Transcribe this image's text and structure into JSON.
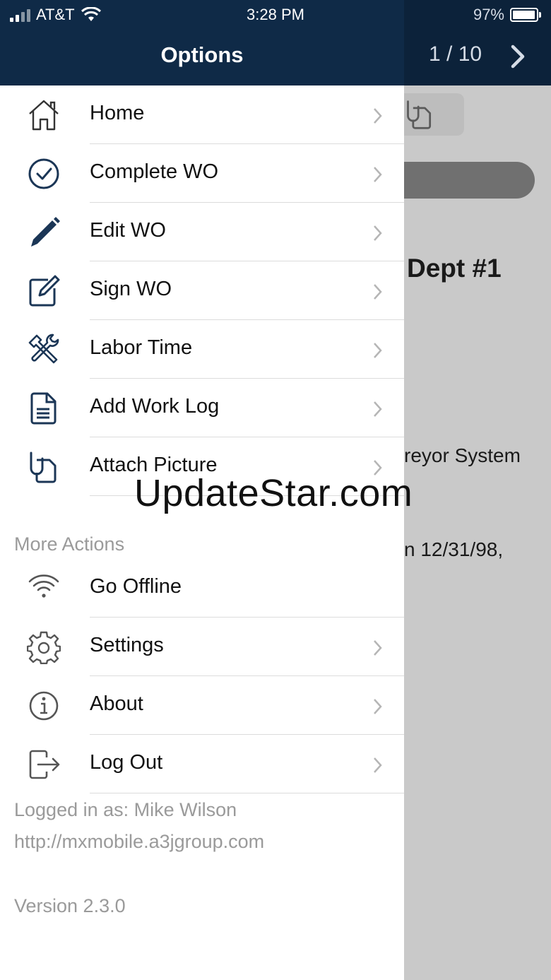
{
  "status_bar": {
    "carrier": "AT&T",
    "time": "3:28 PM",
    "battery": "97%"
  },
  "header": {
    "title": "Options",
    "pager": "1 / 10"
  },
  "background": {
    "heading": "Dept #1",
    "line1": "reyor System",
    "line2": "n 12/31/98,"
  },
  "menu": [
    {
      "label": "Home",
      "icon": "home-icon"
    },
    {
      "label": "Complete WO",
      "icon": "check-circle-icon"
    },
    {
      "label": "Edit WO",
      "icon": "pencil-icon"
    },
    {
      "label": "Sign WO",
      "icon": "edit-square-icon"
    },
    {
      "label": "Labor Time",
      "icon": "tools-icon"
    },
    {
      "label": "Add Work Log",
      "icon": "document-icon"
    },
    {
      "label": "Attach Picture",
      "icon": "paperclip-icon"
    }
  ],
  "more_actions": {
    "title": "More Actions",
    "items": [
      {
        "label": "Go Offline",
        "icon": "wifi-icon"
      },
      {
        "label": "Settings",
        "icon": "gear-icon"
      },
      {
        "label": "About",
        "icon": "info-icon"
      },
      {
        "label": "Log Out",
        "icon": "logout-icon"
      }
    ]
  },
  "footer": {
    "logged_in": "Logged in as: Mike Wilson",
    "server": "http://mxmobile.a3jgroup.com",
    "version": "Version 2.3.0"
  },
  "watermark": "UpdateStar.com",
  "colors": {
    "header": "#0f2a47",
    "icon": "#1b3656",
    "chevron": "#b5b5b5"
  }
}
